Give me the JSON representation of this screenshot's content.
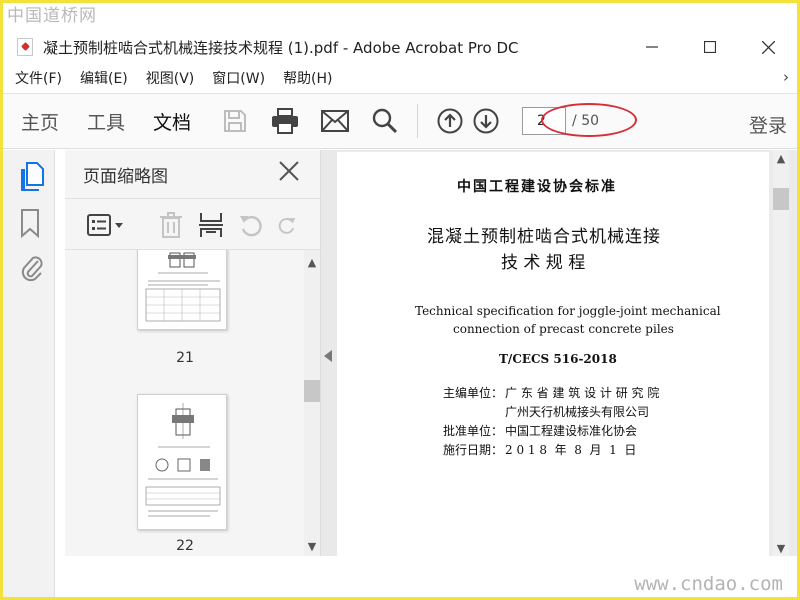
{
  "watermarks": {
    "top": "中国道桥网",
    "bottom": "www.cndao.com"
  },
  "window": {
    "title": "凝土预制桩啮合式机械连接技术规程 (1).pdf - Adobe Acrobat Pro DC",
    "controls": [
      "minimize-icon",
      "maximize-icon",
      "close-icon"
    ]
  },
  "menu": {
    "items": [
      "文件(F)",
      "编辑(E)",
      "视图(V)",
      "窗口(W)",
      "帮助(H)"
    ],
    "more": "›"
  },
  "toolbar": {
    "tabs": [
      "主页",
      "工具",
      "文档"
    ],
    "active_tab": "文档",
    "icons": [
      "save-icon",
      "print-icon",
      "email-icon",
      "search-icon",
      "previous-page-icon",
      "next-page-icon"
    ],
    "current_page": "2",
    "total_pages": "/ 50",
    "login": "登录",
    "highlight_color": "#d5303a"
  },
  "left_rail": {
    "icons": [
      "page-thumbnails-icon",
      "bookmark-icon",
      "attachment-icon"
    ],
    "accent": "#1473e6"
  },
  "thumbnail_panel": {
    "title": "页面缩略图",
    "tools": [
      "thumbnail-options-icon",
      "delete-icon",
      "insert-page-icon",
      "rotate-left-icon",
      "rotate-right-icon"
    ],
    "thumbnails": [
      {
        "page_label": "21"
      },
      {
        "page_label": "22"
      }
    ]
  },
  "document": {
    "org_header": "中国工程建设协会标准",
    "title_line1": "混凝土预制桩啮合式机械连接",
    "title_line2": "技 术 规 程",
    "english_line1": "Technical specification for joggle-joint mechanical",
    "english_line2": "connection of precast concrete piles",
    "code": "T/CECS 516-2018",
    "editor_label": "主编单位：",
    "editor_1": "广 东 省 建 筑 设 计 研 究 院",
    "editor_2": "广州天行机械接头有限公司",
    "approver_label": "批准单位：",
    "approver": "中国工程建设标准化协会",
    "date_label": "施行日期：",
    "date": "2 0 1 8  年  8  月  1  日"
  }
}
